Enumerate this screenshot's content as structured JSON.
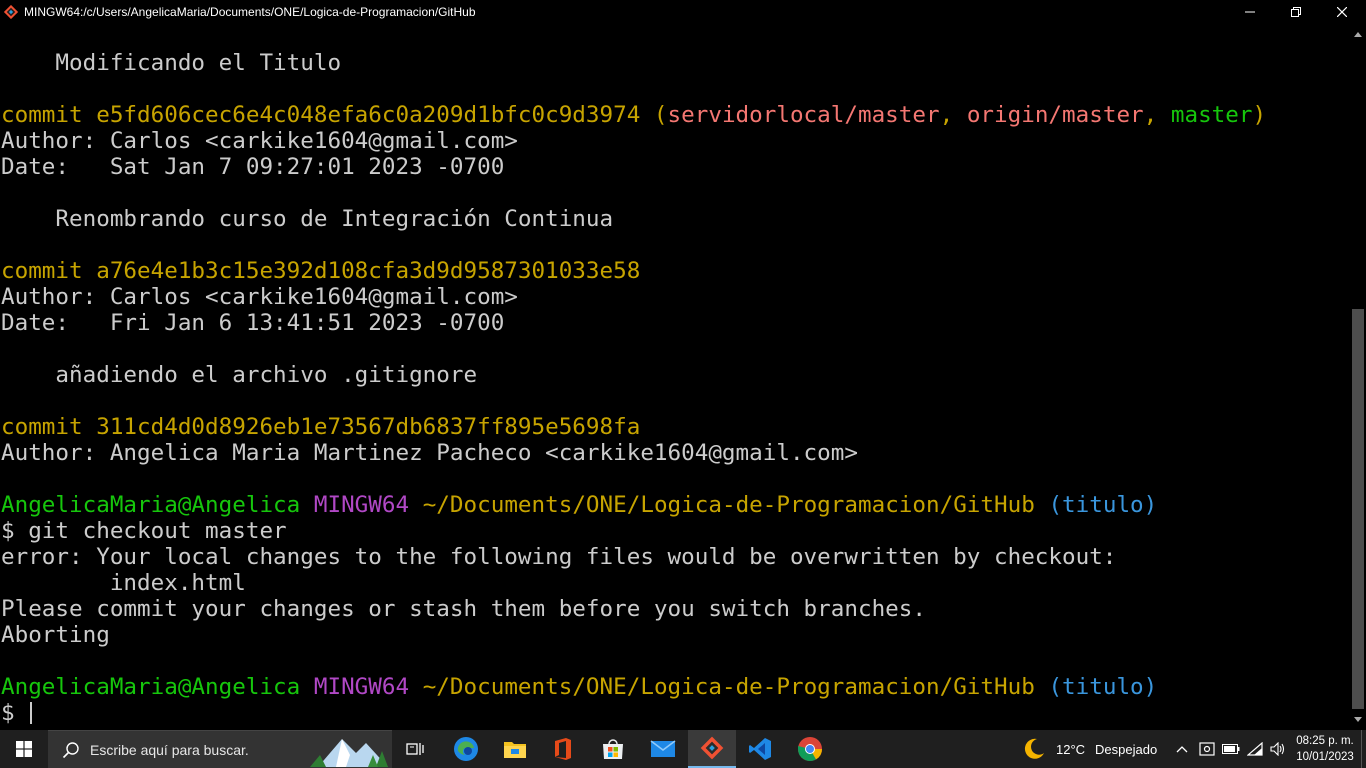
{
  "window": {
    "title": "MINGW64:/c/Users/AngelicaMaria/Documents/ONE/Logica-de-Programacion/GitHub"
  },
  "terminal": {
    "lines": [
      {
        "segments": []
      },
      {
        "segments": [
          {
            "t": "    Modificando el Titulo",
            "c": ""
          }
        ]
      },
      {
        "segments": []
      },
      {
        "segments": [
          {
            "t": "commit e5fd606cec6e4c048efa6c0a209d1bfc0c9d3974 (",
            "c": "yellow"
          },
          {
            "t": "servidorlocal/master",
            "c": "red"
          },
          {
            "t": ", ",
            "c": "yellow"
          },
          {
            "t": "origin/master",
            "c": "red"
          },
          {
            "t": ", ",
            "c": "yellow"
          },
          {
            "t": "master",
            "c": "green"
          },
          {
            "t": ")",
            "c": "yellow"
          }
        ]
      },
      {
        "segments": [
          {
            "t": "Author: Carlos <carkike1604@gmail.com>",
            "c": ""
          }
        ]
      },
      {
        "segments": [
          {
            "t": "Date:   Sat Jan 7 09:27:01 2023 -0700",
            "c": ""
          }
        ]
      },
      {
        "segments": []
      },
      {
        "segments": [
          {
            "t": "    Renombrando curso de Integración Continua",
            "c": ""
          }
        ]
      },
      {
        "segments": []
      },
      {
        "segments": [
          {
            "t": "commit a76e4e1b3c15e392d108cfa3d9d9587301033e58",
            "c": "yellow"
          }
        ]
      },
      {
        "segments": [
          {
            "t": "Author: Carlos <carkike1604@gmail.com>",
            "c": ""
          }
        ]
      },
      {
        "segments": [
          {
            "t": "Date:   Fri Jan 6 13:41:51 2023 -0700",
            "c": ""
          }
        ]
      },
      {
        "segments": []
      },
      {
        "segments": [
          {
            "t": "    añadiendo el archivo .gitignore",
            "c": ""
          }
        ]
      },
      {
        "segments": []
      },
      {
        "segments": [
          {
            "t": "commit 311cd4d0d8926eb1e73567db6837ff895e5698fa",
            "c": "yellow"
          }
        ]
      },
      {
        "segments": [
          {
            "t": "Author: Angelica Maria Martinez Pacheco <carkike1604@gmail.com>",
            "c": ""
          }
        ]
      },
      {
        "segments": []
      },
      {
        "segments": [
          {
            "t": "AngelicaMaria@Angelica ",
            "c": "green"
          },
          {
            "t": "MINGW64 ",
            "c": "magenta"
          },
          {
            "t": "~/Documents/ONE/Logica-de-Programacion/GitHub ",
            "c": "yellow"
          },
          {
            "t": "(titulo)",
            "c": "cyan"
          }
        ]
      },
      {
        "segments": [
          {
            "t": "$ git checkout master",
            "c": ""
          }
        ]
      },
      {
        "segments": [
          {
            "t": "error: Your local changes to the following files would be overwritten by checkout:",
            "c": ""
          }
        ]
      },
      {
        "segments": [
          {
            "t": "        index.html",
            "c": ""
          }
        ]
      },
      {
        "segments": [
          {
            "t": "Please commit your changes or stash them before you switch branches.",
            "c": ""
          }
        ]
      },
      {
        "segments": [
          {
            "t": "Aborting",
            "c": ""
          }
        ]
      },
      {
        "segments": []
      },
      {
        "segments": [
          {
            "t": "AngelicaMaria@Angelica ",
            "c": "green"
          },
          {
            "t": "MINGW64 ",
            "c": "magenta"
          },
          {
            "t": "~/Documents/ONE/Logica-de-Programacion/GitHub ",
            "c": "yellow"
          },
          {
            "t": "(titulo)",
            "c": "cyan"
          }
        ]
      },
      {
        "segments": [
          {
            "t": "$ ",
            "c": ""
          }
        ],
        "cursor": true
      }
    ]
  },
  "taskbar": {
    "search_placeholder": "Escribe aquí para buscar.",
    "pinned": [
      {
        "name": "task-view-icon"
      },
      {
        "name": "edge-icon"
      },
      {
        "name": "file-explorer-icon"
      },
      {
        "name": "office-icon"
      },
      {
        "name": "microsoft-store-icon"
      },
      {
        "name": "mail-icon"
      },
      {
        "name": "git-bash-icon",
        "active": true
      },
      {
        "name": "vscode-icon"
      },
      {
        "name": "chrome-icon"
      }
    ],
    "weather": {
      "temp": "12°C",
      "condition": "Despejado"
    },
    "clock": {
      "time": "08:25 p. m.",
      "date": "10/01/2023"
    }
  },
  "colors": {
    "yellow": "#c7a400",
    "red": "#f47772",
    "green": "#16c60c",
    "magenta": "#b148c6",
    "cyan": "#3a96dd",
    "text": "#cccccc"
  }
}
